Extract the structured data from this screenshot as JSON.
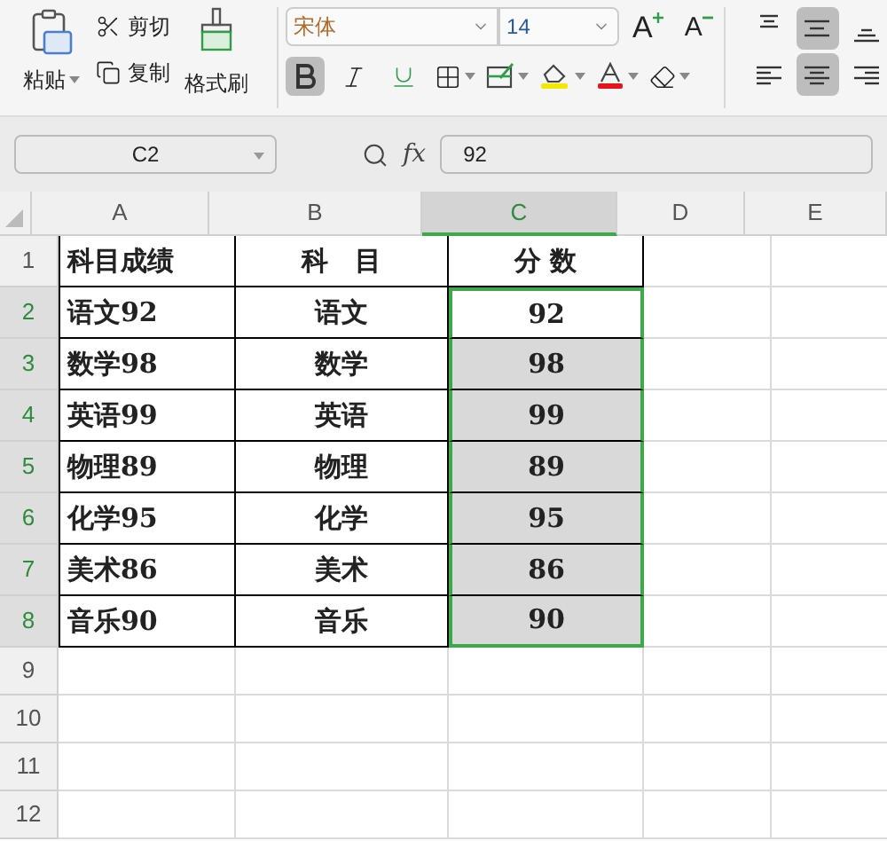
{
  "ribbon": {
    "clipboard": {
      "paste": "粘贴",
      "cut": "剪切",
      "copy": "复制",
      "format_painter": "格式刷"
    },
    "font": {
      "name": "宋体",
      "size": "14",
      "grow": "A",
      "shrink": "A",
      "bold": true,
      "italic": false,
      "underline": false
    },
    "alignment": [
      {
        "kind": "top",
        "selected": false
      },
      {
        "kind": "middle",
        "selected": true
      },
      {
        "kind": "bottom",
        "selected": false
      },
      {
        "kind": "left",
        "selected": false
      },
      {
        "kind": "center",
        "selected": true
      },
      {
        "kind": "right",
        "selected": false
      }
    ]
  },
  "formula_bar": {
    "name_box": "C2",
    "fx": "fx",
    "value": "92"
  },
  "columns": [
    {
      "label": "A",
      "selected": false
    },
    {
      "label": "B",
      "selected": false
    },
    {
      "label": "C",
      "selected": true
    },
    {
      "label": "D",
      "selected": false
    },
    {
      "label": "E",
      "selected": false
    }
  ],
  "rows": [
    {
      "header": "1",
      "selected": false,
      "cells": [
        {
          "text": "科目成绩",
          "selected": false
        },
        {
          "text": "科　目",
          "selected": false
        },
        {
          "text": "分 数",
          "selected": false
        }
      ]
    },
    {
      "header": "2",
      "selected": true,
      "cells": [
        {
          "text": "语文92",
          "selected": false
        },
        {
          "text": "语文",
          "selected": false
        },
        {
          "text": "92",
          "selected": true
        }
      ]
    },
    {
      "header": "3",
      "selected": true,
      "cells": [
        {
          "text": "数学98",
          "selected": false
        },
        {
          "text": "数学",
          "selected": false
        },
        {
          "text": "98",
          "selected": true
        }
      ]
    },
    {
      "header": "4",
      "selected": true,
      "cells": [
        {
          "text": "英语99",
          "selected": false
        },
        {
          "text": "英语",
          "selected": false
        },
        {
          "text": "99",
          "selected": true
        }
      ]
    },
    {
      "header": "5",
      "selected": true,
      "cells": [
        {
          "text": "物理89",
          "selected": false
        },
        {
          "text": "物理",
          "selected": false
        },
        {
          "text": "89",
          "selected": true
        }
      ]
    },
    {
      "header": "6",
      "selected": true,
      "cells": [
        {
          "text": "化学95",
          "selected": false
        },
        {
          "text": "化学",
          "selected": false
        },
        {
          "text": "95",
          "selected": true
        }
      ]
    },
    {
      "header": "7",
      "selected": true,
      "cells": [
        {
          "text": "美术86",
          "selected": false
        },
        {
          "text": "美术",
          "selected": false
        },
        {
          "text": "86",
          "selected": true
        }
      ]
    },
    {
      "header": "8",
      "selected": true,
      "cells": [
        {
          "text": "音乐90",
          "selected": false
        },
        {
          "text": "音乐",
          "selected": false
        },
        {
          "text": "90",
          "selected": true
        }
      ]
    },
    {
      "header": "9",
      "selected": false
    },
    {
      "header": "10",
      "selected": false
    },
    {
      "header": "11",
      "selected": false
    },
    {
      "header": "12",
      "selected": false
    }
  ]
}
